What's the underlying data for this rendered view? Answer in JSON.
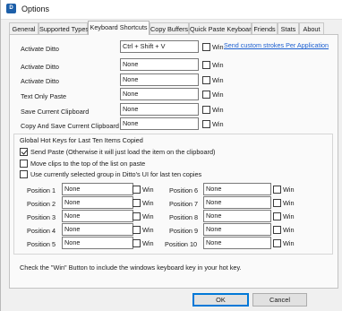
{
  "window": {
    "title": "Options",
    "icon": "ditto-app-icon"
  },
  "tabs": [
    "General",
    "Supported Types",
    "Keyboard Shortcuts",
    "Copy Buffers",
    "Quick Paste Keyboard",
    "Friends",
    "Stats",
    "About"
  ],
  "active_tab": "Keyboard Shortcuts",
  "shortcuts": [
    {
      "label": "Activate Ditto",
      "value": "Ctrl + Shift + V",
      "win_label": "Win",
      "win_checked": false
    },
    {
      "label": "Activate Ditto",
      "value": "None",
      "win_label": "Win",
      "win_checked": false
    },
    {
      "label": "Activate Ditto",
      "value": "None",
      "win_label": "Win",
      "win_checked": false
    },
    {
      "label": "Text Only Paste",
      "value": "None",
      "win_label": "Win",
      "win_checked": false
    },
    {
      "label": "Save Current Clipboard",
      "value": "None",
      "win_label": "Win",
      "win_checked": false
    },
    {
      "label": "Copy And Save Current Clipboard",
      "value": "None",
      "win_label": "Win",
      "win_checked": false
    }
  ],
  "custom_strokes_link": "Send custom strokes Per Application",
  "global_group": {
    "title": "Global Hot Keys for Last Ten Items Copied",
    "options": [
      {
        "label": "Send Paste (Otherwise it will just load the item on the clipboard)",
        "checked": true
      },
      {
        "label": "Move clips to the top of the list on paste",
        "checked": false
      },
      {
        "label": "Use currently selected group in Ditto's UI for last ten copies",
        "checked": false
      }
    ],
    "positions_left": [
      {
        "label": "Position 1",
        "value": "None",
        "win_label": "Win"
      },
      {
        "label": "Position 2",
        "value": "None",
        "win_label": "Win"
      },
      {
        "label": "Position 3",
        "value": "None",
        "win_label": "Win"
      },
      {
        "label": "Position 4",
        "value": "None",
        "win_label": "Win"
      },
      {
        "label": "Position 5",
        "value": "None",
        "win_label": "Win"
      }
    ],
    "positions_right": [
      {
        "label": "Position 6",
        "value": "None",
        "win_label": "Win"
      },
      {
        "label": "Position 7",
        "value": "None",
        "win_label": "Win"
      },
      {
        "label": "Position 8",
        "value": "None",
        "win_label": "Win"
      },
      {
        "label": "Position 9",
        "value": "None",
        "win_label": "Win"
      },
      {
        "label": "Position 10",
        "value": "None",
        "win_label": "Win"
      }
    ]
  },
  "footer_note": "Check the \"Win\" Button to include the windows keyboard key in your hot key.",
  "buttons": {
    "ok": "OK",
    "cancel": "Cancel"
  },
  "colors": {
    "link": "#1c5fd0",
    "default_button_border": "#0078d7"
  }
}
